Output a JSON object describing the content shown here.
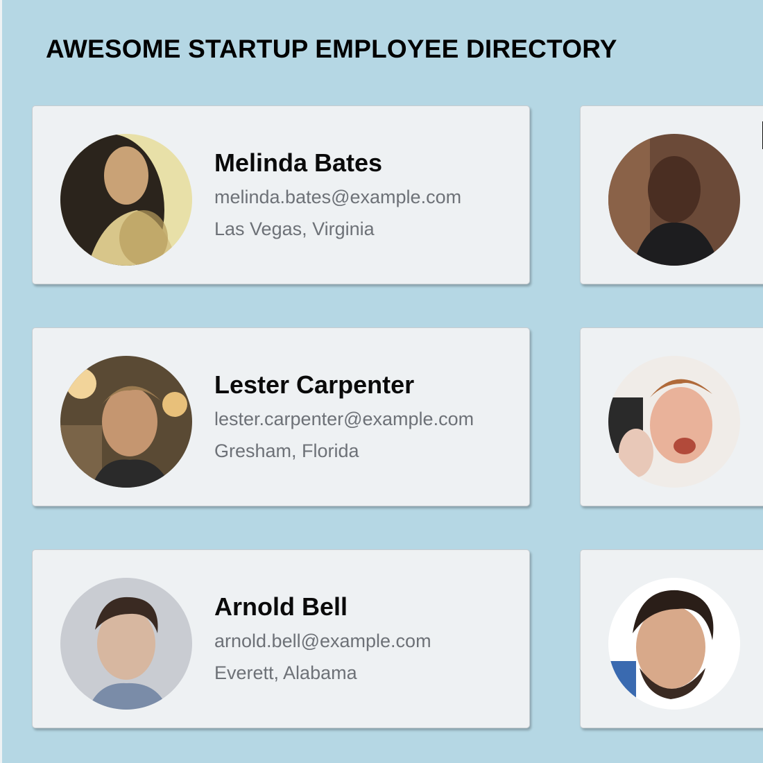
{
  "header": {
    "title": "AWESOME STARTUP EMPLOYEE DIRECTORY"
  },
  "employees": [
    {
      "name": "Melinda Bates",
      "email": "melinda.bates@example.com",
      "location": "Las Vegas, Virginia"
    },
    {
      "name": "Lester Carpenter",
      "email": "lester.carpenter@example.com",
      "location": "Gresham, Florida"
    },
    {
      "name": "Arnold Bell",
      "email": "arnold.bell@example.com",
      "location": "Everett, Alabama"
    }
  ],
  "colors": {
    "background": "#b5d7e4",
    "card": "#eef1f3",
    "name_text": "#0a0a0a",
    "detail_text": "#6d7177"
  }
}
